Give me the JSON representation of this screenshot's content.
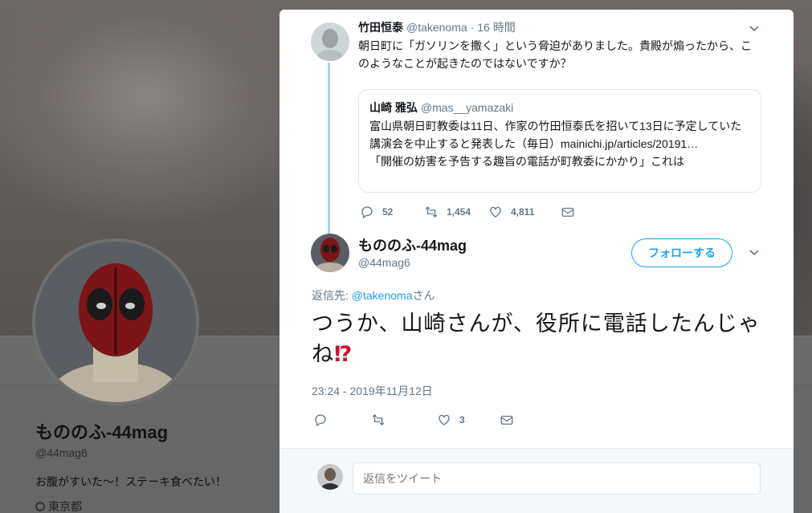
{
  "profile": {
    "name": "もののふ-44mag",
    "handle": "@44mag6",
    "bio": "お腹がすいた〜！ステーキ食べたい！",
    "location": "東京都"
  },
  "parent_tweet": {
    "name": "竹田恒泰",
    "handle": "@takenoma",
    "time": "· 16 時間",
    "text": "朝日町に「ガソリンを撒く」という脅迫がありました。貴殿が煽ったから、このようなことが起きたのではないですか？",
    "quote": {
      "name": "山崎 雅弘",
      "handle": "@mas__yamazaki",
      "text_line1": "富山県朝日町教委は11日、作家の竹田恒泰氏を招いて13日に予定していた講演会を中止すると発表した（毎日）mainichi.jp/articles/20191…",
      "text_line2": "「開催の妨害を予告する趣旨の電話が町教委にかかり」これは"
    },
    "replies": "52",
    "retweets": "1,454",
    "likes": "4,811"
  },
  "main_tweet": {
    "name": "もののふ-44mag",
    "handle": "@44mag6",
    "follow_label": "フォローする",
    "reply_prefix": "返信先: ",
    "reply_handle": "@takenoma",
    "reply_suffix": "さん",
    "text": "つうか、山崎さんが、役所に電話したんじゃね",
    "emoji": "⁉",
    "timestamp": "23:24 - 2019年11月12日",
    "likes": "3"
  },
  "reply_box": {
    "placeholder": "返信をツイート"
  },
  "colors": {
    "accent": "#1da1f2",
    "thread_line": "#a6d4e6",
    "muted": "#657786"
  }
}
